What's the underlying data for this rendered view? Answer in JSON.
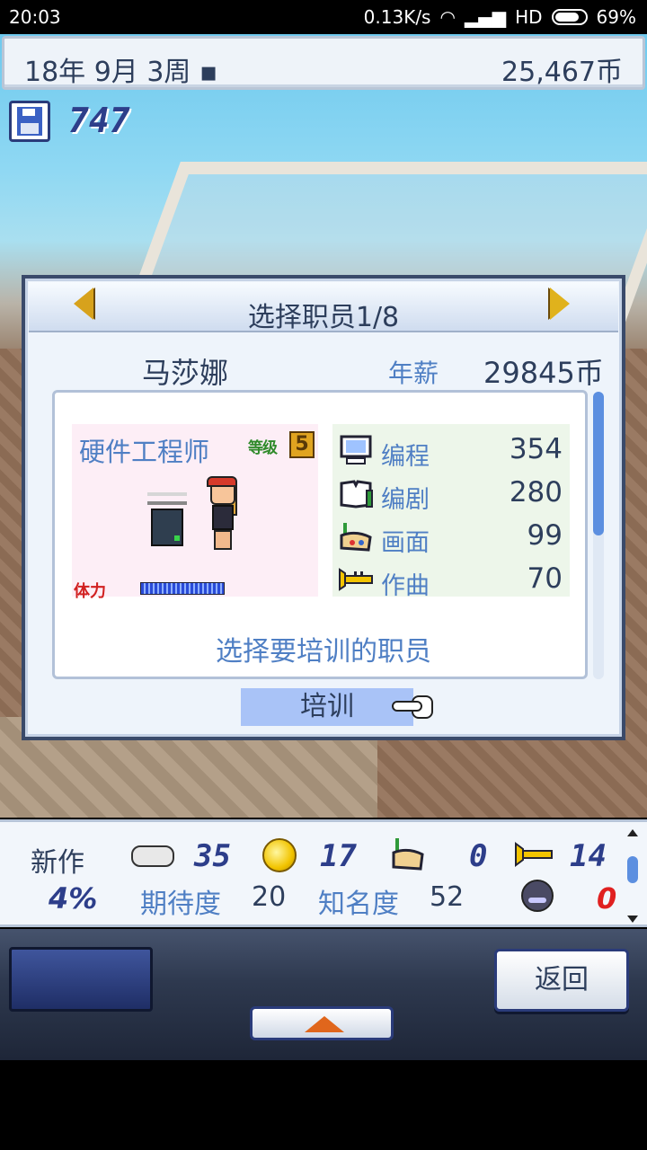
{
  "status_bar": {
    "time": "20:03",
    "network_speed": "0.13K/s",
    "hd": "HD",
    "battery": "69%"
  },
  "top_bar": {
    "date": "18年 9月 3周 ▪",
    "money": "25,467币"
  },
  "save": {
    "count": "747"
  },
  "dialog": {
    "title": "选择职员1/8",
    "staff_name": "马莎娜",
    "salary_label": "年薪",
    "salary_value": "29845币",
    "job": "硬件工程师",
    "level_label": "等级",
    "level": "5",
    "hp_label": "体力",
    "stats": [
      {
        "name": "编程",
        "value": "354",
        "icon": "computer-icon"
      },
      {
        "name": "编剧",
        "value": "280",
        "icon": "book-icon"
      },
      {
        "name": "画面",
        "value": "99",
        "icon": "paint-icon"
      },
      {
        "name": "作曲",
        "value": "70",
        "icon": "trumpet-icon"
      }
    ],
    "prompt": "选择要培训的职员",
    "train_button": "培训"
  },
  "bottom_panel": {
    "new_work": "新作",
    "progress": "4%",
    "fun": "35",
    "creativity": "17",
    "graphics": "0",
    "sound": "14",
    "expectation_label": "期待度",
    "expectation": "20",
    "fame_label": "知名度",
    "fame": "52",
    "bugs": "0"
  },
  "nav": {
    "back": "返回"
  },
  "colors": {
    "accent_blue": "#4f7fc4",
    "dark_text": "#2d3e5c",
    "train_highlight": "#a9c3f7",
    "arrow_gold": "#d7a21c"
  }
}
